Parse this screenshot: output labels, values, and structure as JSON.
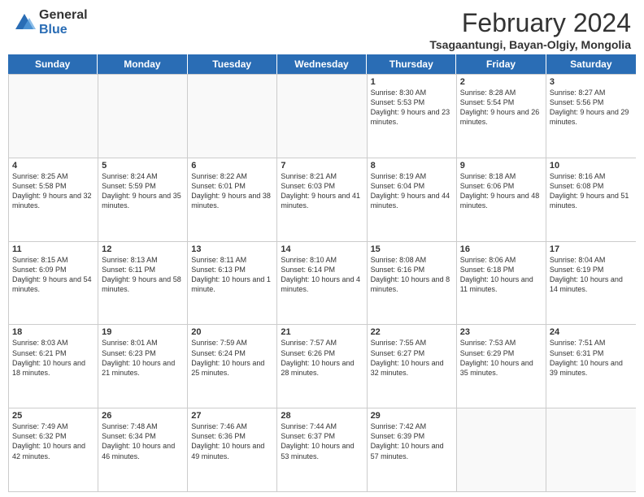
{
  "logo": {
    "general": "General",
    "blue": "Blue"
  },
  "header": {
    "title": "February 2024",
    "subtitle": "Tsagaantungi, Bayan-Olgiy, Mongolia"
  },
  "days": [
    "Sunday",
    "Monday",
    "Tuesday",
    "Wednesday",
    "Thursday",
    "Friday",
    "Saturday"
  ],
  "rows": [
    [
      {
        "day": "",
        "info": ""
      },
      {
        "day": "",
        "info": ""
      },
      {
        "day": "",
        "info": ""
      },
      {
        "day": "",
        "info": ""
      },
      {
        "day": "1",
        "info": "Sunrise: 8:30 AM\nSunset: 5:53 PM\nDaylight: 9 hours and 23 minutes."
      },
      {
        "day": "2",
        "info": "Sunrise: 8:28 AM\nSunset: 5:54 PM\nDaylight: 9 hours and 26 minutes."
      },
      {
        "day": "3",
        "info": "Sunrise: 8:27 AM\nSunset: 5:56 PM\nDaylight: 9 hours and 29 minutes."
      }
    ],
    [
      {
        "day": "4",
        "info": "Sunrise: 8:25 AM\nSunset: 5:58 PM\nDaylight: 9 hours and 32 minutes."
      },
      {
        "day": "5",
        "info": "Sunrise: 8:24 AM\nSunset: 5:59 PM\nDaylight: 9 hours and 35 minutes."
      },
      {
        "day": "6",
        "info": "Sunrise: 8:22 AM\nSunset: 6:01 PM\nDaylight: 9 hours and 38 minutes."
      },
      {
        "day": "7",
        "info": "Sunrise: 8:21 AM\nSunset: 6:03 PM\nDaylight: 9 hours and 41 minutes."
      },
      {
        "day": "8",
        "info": "Sunrise: 8:19 AM\nSunset: 6:04 PM\nDaylight: 9 hours and 44 minutes."
      },
      {
        "day": "9",
        "info": "Sunrise: 8:18 AM\nSunset: 6:06 PM\nDaylight: 9 hours and 48 minutes."
      },
      {
        "day": "10",
        "info": "Sunrise: 8:16 AM\nSunset: 6:08 PM\nDaylight: 9 hours and 51 minutes."
      }
    ],
    [
      {
        "day": "11",
        "info": "Sunrise: 8:15 AM\nSunset: 6:09 PM\nDaylight: 9 hours and 54 minutes."
      },
      {
        "day": "12",
        "info": "Sunrise: 8:13 AM\nSunset: 6:11 PM\nDaylight: 9 hours and 58 minutes."
      },
      {
        "day": "13",
        "info": "Sunrise: 8:11 AM\nSunset: 6:13 PM\nDaylight: 10 hours and 1 minute."
      },
      {
        "day": "14",
        "info": "Sunrise: 8:10 AM\nSunset: 6:14 PM\nDaylight: 10 hours and 4 minutes."
      },
      {
        "day": "15",
        "info": "Sunrise: 8:08 AM\nSunset: 6:16 PM\nDaylight: 10 hours and 8 minutes."
      },
      {
        "day": "16",
        "info": "Sunrise: 8:06 AM\nSunset: 6:18 PM\nDaylight: 10 hours and 11 minutes."
      },
      {
        "day": "17",
        "info": "Sunrise: 8:04 AM\nSunset: 6:19 PM\nDaylight: 10 hours and 14 minutes."
      }
    ],
    [
      {
        "day": "18",
        "info": "Sunrise: 8:03 AM\nSunset: 6:21 PM\nDaylight: 10 hours and 18 minutes."
      },
      {
        "day": "19",
        "info": "Sunrise: 8:01 AM\nSunset: 6:23 PM\nDaylight: 10 hours and 21 minutes."
      },
      {
        "day": "20",
        "info": "Sunrise: 7:59 AM\nSunset: 6:24 PM\nDaylight: 10 hours and 25 minutes."
      },
      {
        "day": "21",
        "info": "Sunrise: 7:57 AM\nSunset: 6:26 PM\nDaylight: 10 hours and 28 minutes."
      },
      {
        "day": "22",
        "info": "Sunrise: 7:55 AM\nSunset: 6:27 PM\nDaylight: 10 hours and 32 minutes."
      },
      {
        "day": "23",
        "info": "Sunrise: 7:53 AM\nSunset: 6:29 PM\nDaylight: 10 hours and 35 minutes."
      },
      {
        "day": "24",
        "info": "Sunrise: 7:51 AM\nSunset: 6:31 PM\nDaylight: 10 hours and 39 minutes."
      }
    ],
    [
      {
        "day": "25",
        "info": "Sunrise: 7:49 AM\nSunset: 6:32 PM\nDaylight: 10 hours and 42 minutes."
      },
      {
        "day": "26",
        "info": "Sunrise: 7:48 AM\nSunset: 6:34 PM\nDaylight: 10 hours and 46 minutes."
      },
      {
        "day": "27",
        "info": "Sunrise: 7:46 AM\nSunset: 6:36 PM\nDaylight: 10 hours and 49 minutes."
      },
      {
        "day": "28",
        "info": "Sunrise: 7:44 AM\nSunset: 6:37 PM\nDaylight: 10 hours and 53 minutes."
      },
      {
        "day": "29",
        "info": "Sunrise: 7:42 AM\nSunset: 6:39 PM\nDaylight: 10 hours and 57 minutes."
      },
      {
        "day": "",
        "info": ""
      },
      {
        "day": "",
        "info": ""
      }
    ]
  ]
}
